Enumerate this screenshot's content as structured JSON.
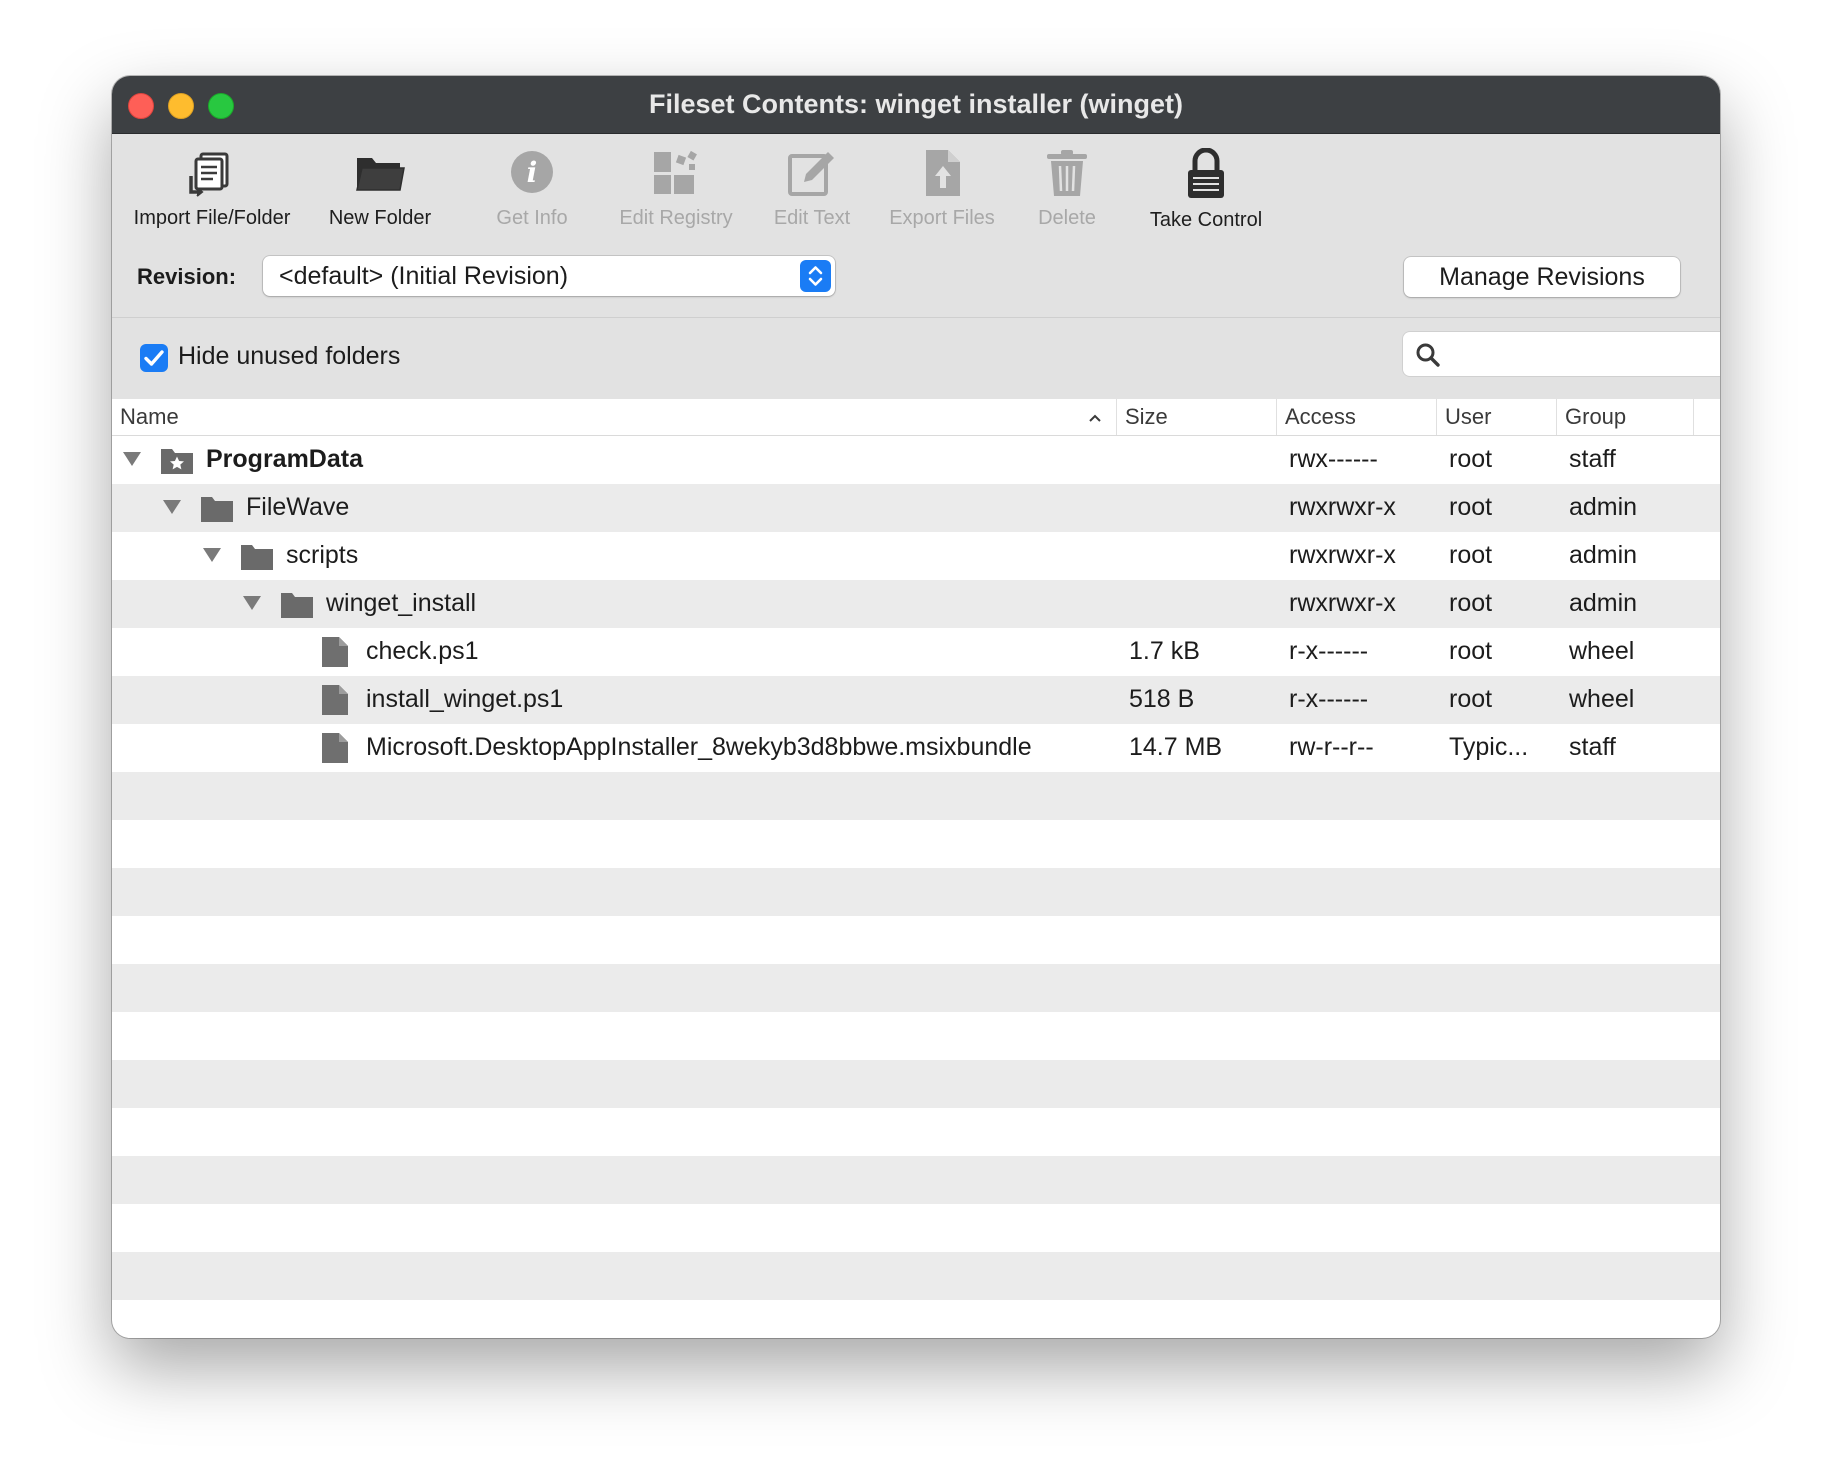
{
  "window": {
    "title": "Fileset Contents: winget installer (winget)"
  },
  "toolbar": {
    "items": [
      {
        "label": "Import File/Folder",
        "icon": "import-icon",
        "enabled": true
      },
      {
        "label": "New Folder",
        "icon": "folder-icon",
        "enabled": true
      },
      {
        "label": "Get Info",
        "icon": "info-icon",
        "enabled": false
      },
      {
        "label": "Edit Registry",
        "icon": "registry-icon",
        "enabled": false
      },
      {
        "label": "Edit Text",
        "icon": "edit-text-icon",
        "enabled": false
      },
      {
        "label": "Export Files",
        "icon": "export-icon",
        "enabled": false
      },
      {
        "label": "Delete",
        "icon": "trash-icon",
        "enabled": false
      },
      {
        "label": "Take Control",
        "icon": "lock-icon",
        "enabled": true
      }
    ]
  },
  "revision": {
    "label": "Revision:",
    "selected": "<default> (Initial Revision)",
    "manage_label": "Manage Revisions"
  },
  "options": {
    "hide_unused_label": "Hide unused folders",
    "hide_unused_checked": true,
    "search_placeholder": ""
  },
  "table": {
    "columns": [
      "Name",
      "Size",
      "Access",
      "User",
      "Group"
    ],
    "sorted_column": "Name",
    "rows": [
      {
        "name": "ProgramData",
        "size": "",
        "access": "rwx------",
        "user": "root",
        "group": "staff",
        "kind": "special-folder",
        "level": 0,
        "expanded": true,
        "bold": true
      },
      {
        "name": "FileWave",
        "size": "",
        "access": "rwxrwxr-x",
        "user": "root",
        "group": "admin",
        "kind": "folder",
        "level": 1,
        "expanded": true,
        "bold": false
      },
      {
        "name": "scripts",
        "size": "",
        "access": "rwxrwxr-x",
        "user": "root",
        "group": "admin",
        "kind": "folder",
        "level": 2,
        "expanded": true,
        "bold": false
      },
      {
        "name": "winget_install",
        "size": "",
        "access": "rwxrwxr-x",
        "user": "root",
        "group": "admin",
        "kind": "folder",
        "level": 3,
        "expanded": true,
        "bold": false
      },
      {
        "name": "check.ps1",
        "size": "1.7 kB",
        "access": "r-x------",
        "user": "root",
        "group": "wheel",
        "kind": "file",
        "level": 4,
        "expanded": false,
        "bold": false
      },
      {
        "name": "install_winget.ps1",
        "size": "518 B",
        "access": "r-x------",
        "user": "root",
        "group": "wheel",
        "kind": "file",
        "level": 4,
        "expanded": false,
        "bold": false
      },
      {
        "name": "Microsoft.DesktopAppInstaller_8wekyb3d8bbwe.msixbundle",
        "size": "14.7 MB",
        "access": "rw-r--r--",
        "user": "Typic...",
        "group": "staff",
        "kind": "file",
        "level": 4,
        "expanded": false,
        "bold": false
      }
    ]
  },
  "colors": {
    "titlebar": "#3d4043",
    "accent": "#1a7cf5",
    "stripe": "#ebebeb"
  }
}
